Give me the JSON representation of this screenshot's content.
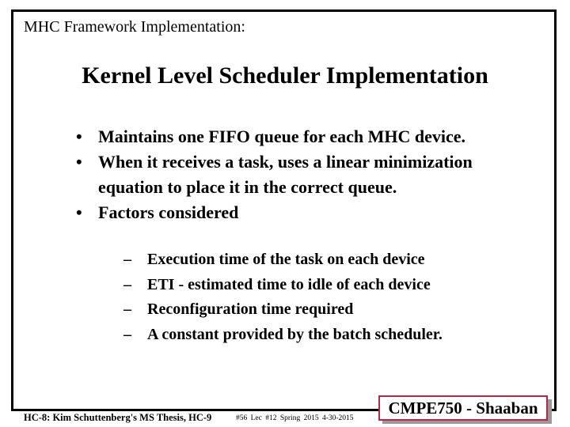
{
  "slide": {
    "section_title": "MHC Framework Implementation:",
    "title": "Kernel Level Scheduler Implementation",
    "bullets": [
      {
        "glyph": "•",
        "text": "Maintains one FIFO queue for each MHC device."
      },
      {
        "glyph": "•",
        "text": "When it receives a task, uses a linear minimization equation to place it in the correct queue."
      },
      {
        "glyph": "•",
        "text": "Factors considered"
      }
    ],
    "subbullets": [
      {
        "glyph": "–",
        "text": "Execution time of the task on each device"
      },
      {
        "glyph": "–",
        "text": "ETI - estimated time to idle of each device"
      },
      {
        "glyph": "–",
        "text": "Reconfiguration time required"
      },
      {
        "glyph": "–",
        "text": "A constant provided by the batch scheduler."
      }
    ]
  },
  "footer": {
    "left": "HC-8: Kim Schuttenberg's MS Thesis, HC-9",
    "slide_info": "#56 Lec #12 Spring 2015 4-30-2015",
    "badge": "CMPE750 - Shaaban"
  },
  "colors": {
    "badge_border": "#b5284a",
    "badge_shadow": "#9a9a9a",
    "frame": "#000000"
  }
}
